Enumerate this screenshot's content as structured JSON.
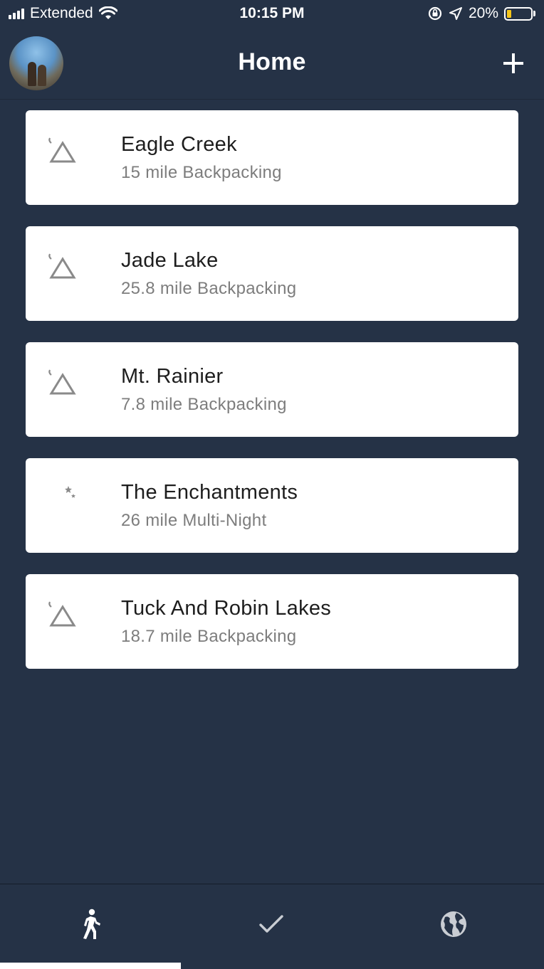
{
  "status_bar": {
    "carrier": "Extended",
    "time": "10:15 PM",
    "battery_percent": "20%",
    "battery_level": 0.2,
    "icons": [
      "signal-icon",
      "wifi-icon",
      "orientation-lock-icon",
      "location-icon",
      "battery-icon"
    ]
  },
  "header": {
    "title": "Home",
    "avatar": "profile-avatar",
    "add_icon": "plus-icon"
  },
  "trips": [
    {
      "name": "Eagle Creek",
      "description": "15 mile Backpacking",
      "icon": "tent-icon"
    },
    {
      "name": "Jade Lake",
      "description": "25.8 mile Backpacking",
      "icon": "tent-icon"
    },
    {
      "name": "Mt. Rainier",
      "description": "7.8 mile Backpacking",
      "icon": "tent-icon"
    },
    {
      "name": "The Enchantments",
      "description": "26 mile Multi-Night",
      "icon": "moon-stars-icon"
    },
    {
      "name": "Tuck And Robin Lakes",
      "description": "18.7 mile Backpacking",
      "icon": "tent-icon"
    }
  ],
  "tab_bar": {
    "tabs": [
      {
        "icon": "hiker-icon",
        "active": true
      },
      {
        "icon": "checkmark-icon",
        "active": false
      },
      {
        "icon": "globe-icon",
        "active": false
      }
    ]
  },
  "colors": {
    "background": "#253246",
    "card": "#ffffff",
    "title_text": "#1d1d1d",
    "subtitle_text": "#7d7d7d",
    "icon_gray": "#8a8a8a",
    "battery_fill": "#f5c518"
  }
}
